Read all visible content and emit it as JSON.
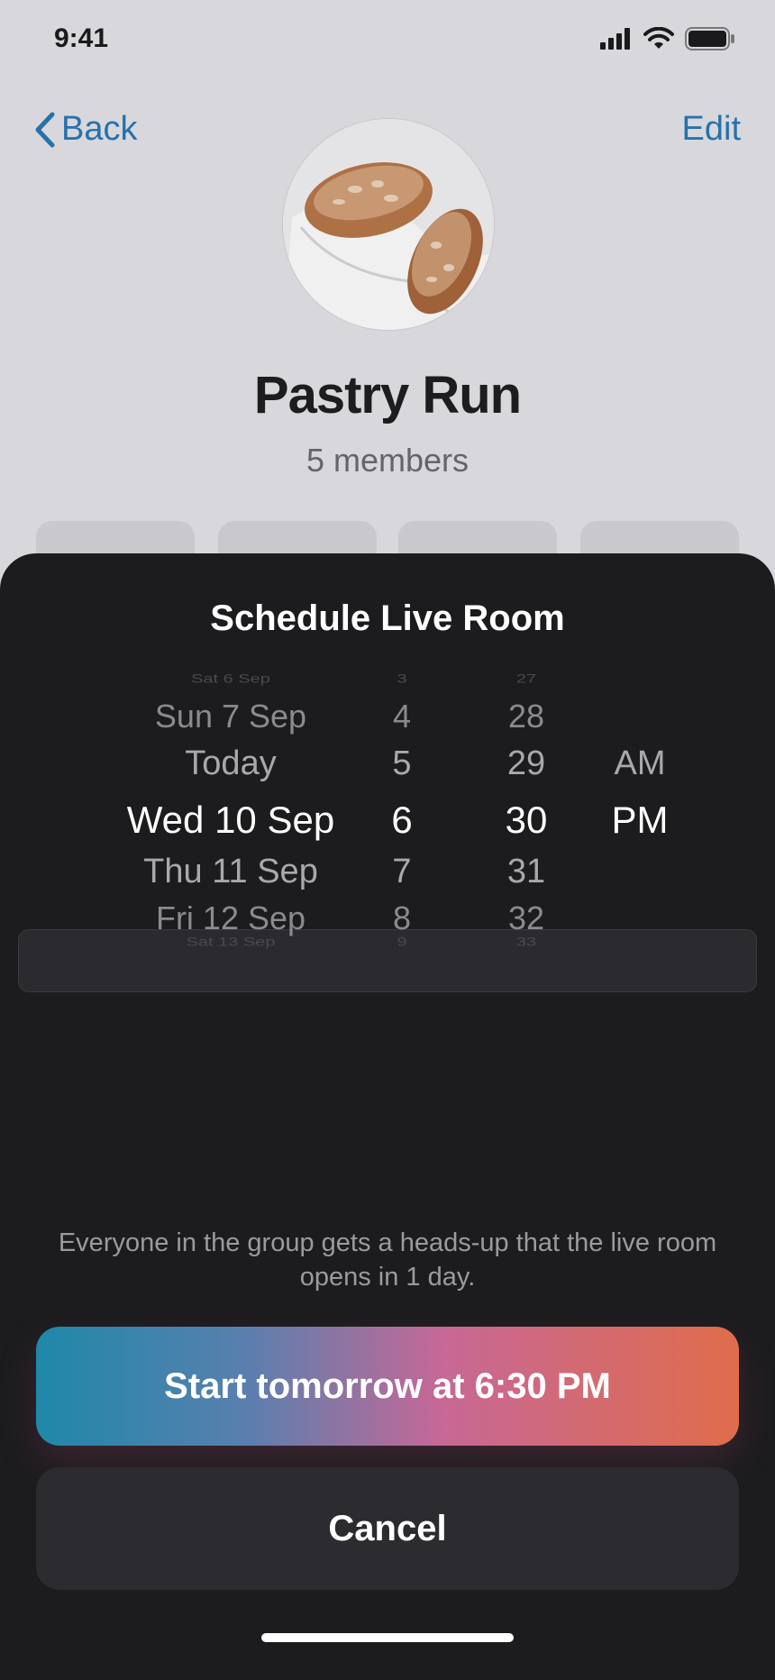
{
  "status_bar": {
    "time": "9:41"
  },
  "nav": {
    "back_label": "Back",
    "edit_label": "Edit"
  },
  "group": {
    "name": "Pastry Run",
    "members": "5 members"
  },
  "sheet": {
    "title": "Schedule Live Room",
    "picker": {
      "dates": [
        "Sat 6 Sep",
        "Sun 7 Sep",
        "Today",
        "Wed 10 Sep",
        "Thu 11 Sep",
        "Fri 12 Sep",
        "Sat 13 Sep"
      ],
      "hours": [
        "3",
        "4",
        "5",
        "6",
        "7",
        "8",
        "9"
      ],
      "minutes": [
        "27",
        "28",
        "29",
        "30",
        "31",
        "32",
        "33"
      ],
      "ampm": [
        "",
        "",
        "AM",
        "PM",
        "",
        "",
        ""
      ],
      "selected": {
        "date": "Wed 10 Sep",
        "hour": "6",
        "minute": "30",
        "ampm": "PM"
      }
    },
    "note": "Everyone in the group gets a heads-up that the live room opens in 1 day.",
    "primary_button": "Start tomorrow at 6:30 PM",
    "cancel_button": "Cancel"
  },
  "colors": {
    "accent": "#2a79b8",
    "sheet_bg": "#1c1c1e",
    "gradient_start": "#1f88a9",
    "gradient_end": "#e06c4b"
  },
  "icons": [
    "chevron-left-icon",
    "cellular-signal-icon",
    "wifi-icon",
    "battery-icon"
  ]
}
